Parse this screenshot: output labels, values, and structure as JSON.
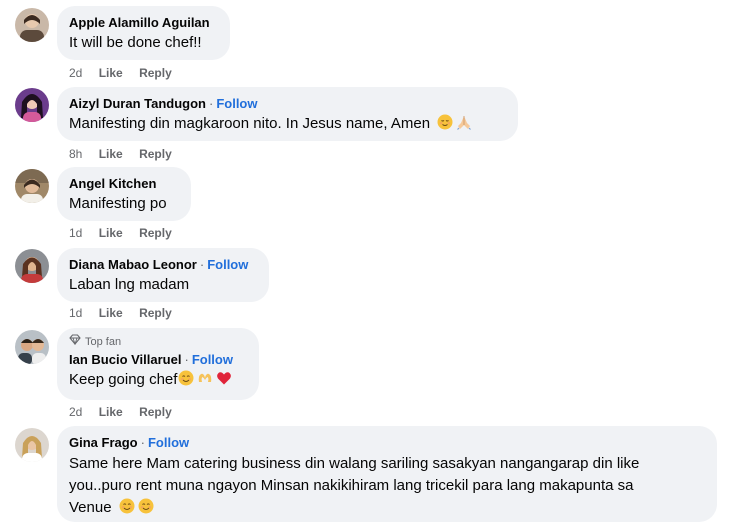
{
  "comments": [
    {
      "author": "Apple Alamillo Aguilan",
      "text": "It will be done chef!!",
      "time": "2d",
      "like": "Like",
      "reply": "Reply"
    },
    {
      "author": "Aizyl Duran Tandugon",
      "follow": "Follow",
      "text": "Manifesting din magkaroon nito. In Jesus name, Amen",
      "emojis": [
        "relieved-face",
        "folded-hands"
      ],
      "time": "8h",
      "like": "Like",
      "reply": "Reply"
    },
    {
      "author": "Angel Kitchen",
      "text": "Manifesting po",
      "time": "1d",
      "like": "Like",
      "reply": "Reply"
    },
    {
      "author": "Diana Mabao Leonor",
      "follow": "Follow",
      "text": "Laban lng madam",
      "time": "1d",
      "like": "Like",
      "reply": "Reply"
    },
    {
      "badge": "Top fan",
      "author": "Ian Bucio Villaruel",
      "follow": "Follow",
      "text": "Keep going chef",
      "emojis": [
        "smiling-face",
        "heart-hands",
        "red-heart"
      ],
      "time": "2d",
      "like": "Like",
      "reply": "Reply"
    },
    {
      "author": "Gina Frago",
      "follow": "Follow",
      "text_lines": [
        "Same here Mam catering business din walang sariling sasakyan nangangarap din like",
        "you..puro rent muna ngayon Minsan nakikihiram lang tricekil para lang makapunta sa",
        "Venue"
      ],
      "emojis": [
        "smiling-face",
        "smiling-face"
      ]
    }
  ],
  "separator": "·",
  "colors": {
    "bubble": "#f0f2f5",
    "follow": "#216fdb",
    "meta": "#65676b",
    "text": "#050505"
  }
}
